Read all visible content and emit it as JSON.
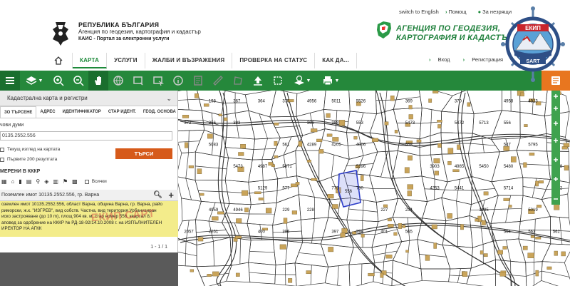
{
  "header": {
    "switch_english": "switch to English",
    "help": "Помощ",
    "favorites": "За незрящи",
    "org_line1": "РЕПУБЛИКА БЪЛГАРИЯ",
    "org_line2": "Агенция по геодезия, картография и кадастър",
    "org_line3": "КАИС - Портал за електронни услуги",
    "agency_line1": "АГЕНЦИЯ ПО ГЕОДЕЗИЯ,",
    "agency_line2": "КАРТОГРАФИЯ И КАДАСТЪР"
  },
  "badge": {
    "top_text": "ЕКИП",
    "bottom_text": "SART"
  },
  "nav": {
    "items": [
      "КАРТА",
      "УСЛУГИ",
      "ЖАЛБИ И ВЪЗРАЖЕНИЯ",
      "ПРОВЕРКА НА СТАТУС",
      "КАК ДА..."
    ],
    "login": "Вход",
    "register": "Регистрация"
  },
  "panel": {
    "title": "Кадастрална карта и регистри",
    "tabs": [
      "ЗО ТЪРСЕНЕ",
      "АДРЕС",
      "ИДЕНТИФИКАТОР",
      "СТАР ИДЕНТ.",
      "ГЕОД. ОСНОВА"
    ],
    "keywords_label": "чови думи",
    "keywords_value": "0135.2552.556",
    "current_view": "Текущ изглед на картата",
    "first_results": "Първите 200 резултата",
    "search_button": "ТЪРСИ",
    "objects_label": "МЕРЕНИ В КККР",
    "all_label": "Всички",
    "results_header": "Поземлен имот 10135.2552.556, гр. Варна",
    "result_lines": [
      "оземлен имот 10135.2552.556, област Варна, община Варна, гр. Варна, райо",
      "риморски, ж.к. \"ИЗГРЕВ\", вид собств. Частна, вид територия Урбанизиран",
      "иско застрояване (до 10 m), площ 904 кв. м, стар номер 556, квартал 8,",
      "аповед за одобрение на КККР № РД-18-92/14.10.2008 г. на ИЗПЪЛНИТЕЛЕН",
      "ИРЕКТОР НА АГКК"
    ],
    "watermark": "ЕКИП САРТ",
    "pager": "1 - 1 / 1"
  },
  "map": {
    "labels": [
      "198",
      "367",
      "364",
      "375",
      "4956",
      "5011",
      "5526",
      "369",
      "370",
      "4958",
      "4913",
      "372",
      "356",
      "383",
      "366",
      "388",
      "553",
      "5473",
      "5472",
      "5713",
      "556",
      "555",
      "5083",
      "561",
      "4289",
      "4205",
      "4006",
      "558",
      "547",
      "5795",
      "5473",
      "4987",
      "5871",
      "5396",
      "3903",
      "4985",
      "5450",
      "5480",
      "5128",
      "5129",
      "577",
      "779",
      "780",
      "4253",
      "5441",
      "5714",
      "4922",
      "4959",
      "4946",
      "229",
      "228",
      "227",
      "234",
      "1095",
      "5019",
      "2057",
      "2251",
      "400",
      "396",
      "397",
      "398",
      "401",
      "565",
      "564",
      "563",
      "562"
    ],
    "colors": {
      "highlight": "#2d3dc8",
      "building": "#c9a45a",
      "line": "#333333"
    }
  },
  "toolbar": {
    "icons": [
      "menu-icon",
      "layers-icon",
      "zoom-in-icon",
      "zoom-out-icon",
      "hand-icon",
      "globe-icon",
      "box-select-icon",
      "select-icon",
      "info-icon",
      "measure-area-icon",
      "ruler-icon",
      "polygon-icon",
      "upload-icon",
      "crop-icon",
      "layer-info-icon",
      "print-icon"
    ]
  }
}
